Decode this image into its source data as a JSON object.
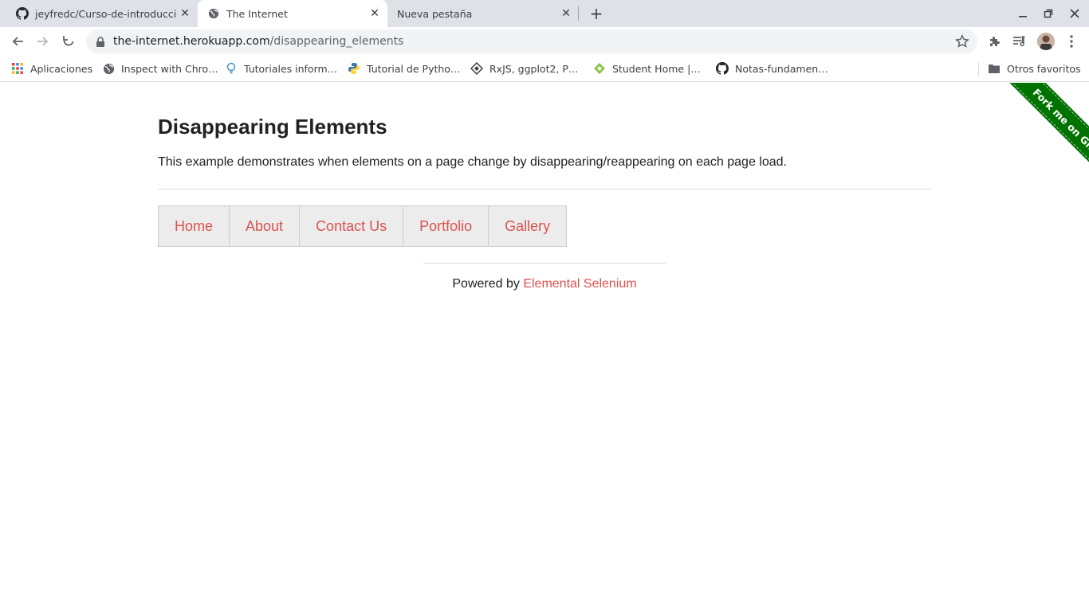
{
  "tabs": [
    {
      "title": "jeyfredc/Curso-de-introduccio",
      "icon": "github-icon",
      "close": "✕"
    },
    {
      "title": "The Internet",
      "icon": "globe-icon",
      "close": "✕"
    },
    {
      "title": "Nueva pestaña",
      "icon": "",
      "close": "✕"
    }
  ],
  "new_tab_symbol": "+",
  "address_bar": {
    "host": "the-internet.herokuapp.com",
    "path": "/disappearing_elements"
  },
  "bookmarks": [
    {
      "label": "Aplicaciones",
      "icon": "apps-grid-icon"
    },
    {
      "label": "Inspect with Chro…",
      "icon": "globe-icon"
    },
    {
      "label": "Tutoriales inform…",
      "icon": "bulb-icon"
    },
    {
      "label": "Tutorial de Pytho…",
      "icon": "python-icon"
    },
    {
      "label": "RxJS, ggplot2, P…",
      "icon": "diamond-icon"
    },
    {
      "label": "Student Home |…",
      "icon": "diamond-green-icon"
    },
    {
      "label": "Notas-fundamen…",
      "icon": "github-icon"
    }
  ],
  "other_bookmarks": "Otros favoritos",
  "page": {
    "ribbon": "Fork me on GitHub",
    "heading": "Disappearing Elements",
    "description": "This example demonstrates when elements on a page change by disappearing/reappearing on each page load.",
    "menu": [
      "Home",
      "About",
      "Contact Us",
      "Portfolio",
      "Gallery"
    ],
    "footer_prefix": "Powered by ",
    "footer_link": "Elemental Selenium"
  },
  "colors": {
    "link": "#d9534f",
    "ribbon": "#007200",
    "tabstrip": "#dee1e6"
  }
}
